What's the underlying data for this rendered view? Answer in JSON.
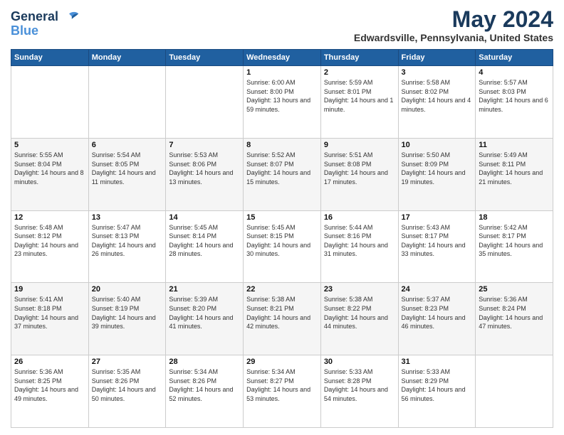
{
  "header": {
    "logo_line1": "General",
    "logo_line2": "Blue",
    "month": "May 2024",
    "location": "Edwardsville, Pennsylvania, United States"
  },
  "weekdays": [
    "Sunday",
    "Monday",
    "Tuesday",
    "Wednesday",
    "Thursday",
    "Friday",
    "Saturday"
  ],
  "weeks": [
    [
      {
        "day": "",
        "sunrise": "",
        "sunset": "",
        "daylight": ""
      },
      {
        "day": "",
        "sunrise": "",
        "sunset": "",
        "daylight": ""
      },
      {
        "day": "",
        "sunrise": "",
        "sunset": "",
        "daylight": ""
      },
      {
        "day": "1",
        "sunrise": "6:00 AM",
        "sunset": "8:00 PM",
        "daylight": "13 hours and 59 minutes."
      },
      {
        "day": "2",
        "sunrise": "5:59 AM",
        "sunset": "8:01 PM",
        "daylight": "14 hours and 1 minute."
      },
      {
        "day": "3",
        "sunrise": "5:58 AM",
        "sunset": "8:02 PM",
        "daylight": "14 hours and 4 minutes."
      },
      {
        "day": "4",
        "sunrise": "5:57 AM",
        "sunset": "8:03 PM",
        "daylight": "14 hours and 6 minutes."
      }
    ],
    [
      {
        "day": "5",
        "sunrise": "5:55 AM",
        "sunset": "8:04 PM",
        "daylight": "14 hours and 8 minutes."
      },
      {
        "day": "6",
        "sunrise": "5:54 AM",
        "sunset": "8:05 PM",
        "daylight": "14 hours and 11 minutes."
      },
      {
        "day": "7",
        "sunrise": "5:53 AM",
        "sunset": "8:06 PM",
        "daylight": "14 hours and 13 minutes."
      },
      {
        "day": "8",
        "sunrise": "5:52 AM",
        "sunset": "8:07 PM",
        "daylight": "14 hours and 15 minutes."
      },
      {
        "day": "9",
        "sunrise": "5:51 AM",
        "sunset": "8:08 PM",
        "daylight": "14 hours and 17 minutes."
      },
      {
        "day": "10",
        "sunrise": "5:50 AM",
        "sunset": "8:09 PM",
        "daylight": "14 hours and 19 minutes."
      },
      {
        "day": "11",
        "sunrise": "5:49 AM",
        "sunset": "8:11 PM",
        "daylight": "14 hours and 21 minutes."
      }
    ],
    [
      {
        "day": "12",
        "sunrise": "5:48 AM",
        "sunset": "8:12 PM",
        "daylight": "14 hours and 23 minutes."
      },
      {
        "day": "13",
        "sunrise": "5:47 AM",
        "sunset": "8:13 PM",
        "daylight": "14 hours and 26 minutes."
      },
      {
        "day": "14",
        "sunrise": "5:45 AM",
        "sunset": "8:14 PM",
        "daylight": "14 hours and 28 minutes."
      },
      {
        "day": "15",
        "sunrise": "5:45 AM",
        "sunset": "8:15 PM",
        "daylight": "14 hours and 30 minutes."
      },
      {
        "day": "16",
        "sunrise": "5:44 AM",
        "sunset": "8:16 PM",
        "daylight": "14 hours and 31 minutes."
      },
      {
        "day": "17",
        "sunrise": "5:43 AM",
        "sunset": "8:17 PM",
        "daylight": "14 hours and 33 minutes."
      },
      {
        "day": "18",
        "sunrise": "5:42 AM",
        "sunset": "8:17 PM",
        "daylight": "14 hours and 35 minutes."
      }
    ],
    [
      {
        "day": "19",
        "sunrise": "5:41 AM",
        "sunset": "8:18 PM",
        "daylight": "14 hours and 37 minutes."
      },
      {
        "day": "20",
        "sunrise": "5:40 AM",
        "sunset": "8:19 PM",
        "daylight": "14 hours and 39 minutes."
      },
      {
        "day": "21",
        "sunrise": "5:39 AM",
        "sunset": "8:20 PM",
        "daylight": "14 hours and 41 minutes."
      },
      {
        "day": "22",
        "sunrise": "5:38 AM",
        "sunset": "8:21 PM",
        "daylight": "14 hours and 42 minutes."
      },
      {
        "day": "23",
        "sunrise": "5:38 AM",
        "sunset": "8:22 PM",
        "daylight": "14 hours and 44 minutes."
      },
      {
        "day": "24",
        "sunrise": "5:37 AM",
        "sunset": "8:23 PM",
        "daylight": "14 hours and 46 minutes."
      },
      {
        "day": "25",
        "sunrise": "5:36 AM",
        "sunset": "8:24 PM",
        "daylight": "14 hours and 47 minutes."
      }
    ],
    [
      {
        "day": "26",
        "sunrise": "5:36 AM",
        "sunset": "8:25 PM",
        "daylight": "14 hours and 49 minutes."
      },
      {
        "day": "27",
        "sunrise": "5:35 AM",
        "sunset": "8:26 PM",
        "daylight": "14 hours and 50 minutes."
      },
      {
        "day": "28",
        "sunrise": "5:34 AM",
        "sunset": "8:26 PM",
        "daylight": "14 hours and 52 minutes."
      },
      {
        "day": "29",
        "sunrise": "5:34 AM",
        "sunset": "8:27 PM",
        "daylight": "14 hours and 53 minutes."
      },
      {
        "day": "30",
        "sunrise": "5:33 AM",
        "sunset": "8:28 PM",
        "daylight": "14 hours and 54 minutes."
      },
      {
        "day": "31",
        "sunrise": "5:33 AM",
        "sunset": "8:29 PM",
        "daylight": "14 hours and 56 minutes."
      },
      {
        "day": "",
        "sunrise": "",
        "sunset": "",
        "daylight": ""
      }
    ]
  ]
}
